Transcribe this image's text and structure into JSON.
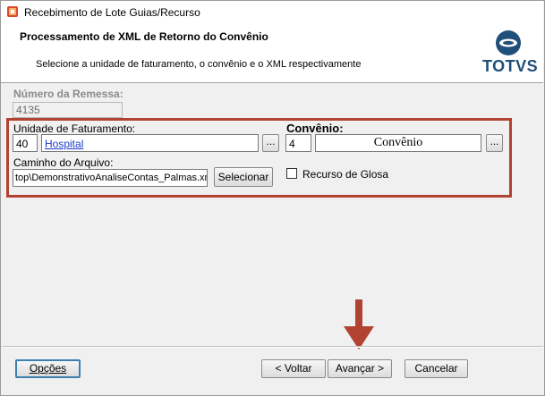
{
  "window": {
    "title": "Recebimento de Lote Guias/Recurso"
  },
  "header": {
    "title": "Processamento de XML de Retorno do Convênio",
    "subtitle": "Selecione a unidade de faturamento, o convênio e o XML respectivamente",
    "logo_text": "TOTVS"
  },
  "remessa": {
    "label": "Número da Remessa:",
    "value": "4135"
  },
  "unidade": {
    "label": "Unidade de Faturamento:",
    "code": "40",
    "name": "Hospital",
    "lookup": "..."
  },
  "convenio": {
    "label": "Convênio:",
    "code": "4",
    "name": "Convênio",
    "lookup": "..."
  },
  "caminho": {
    "label": "Caminho do Arquivo:",
    "value": "top\\DemonstrativoAnaliseContas_Palmas.xml",
    "button": "Selecionar"
  },
  "recurso": {
    "label": "Recurso de Glosa",
    "checked": false
  },
  "footer": {
    "options": "Opções",
    "back": "< Voltar",
    "next": "Avançar >",
    "cancel": "Cancelar"
  },
  "colors": {
    "highlight": "#b24333",
    "logo": "#1f4f7a"
  }
}
